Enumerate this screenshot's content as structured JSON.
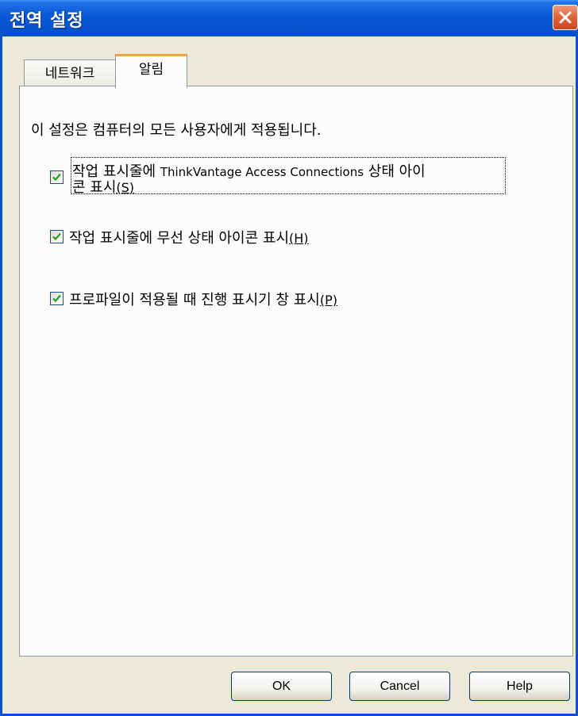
{
  "window": {
    "title": "전역 설정"
  },
  "tabs": [
    {
      "label": "네트워크",
      "selected": false
    },
    {
      "label": "알림",
      "selected": true
    }
  ],
  "panel": {
    "info_text": "이 설정은 컴퓨터의 모든 사용자에게 적용됩니다.",
    "checkboxes": [
      {
        "line1_prefix": "작업 표시줄에 ",
        "line1_mixed": "ThinkVantage Access Connections",
        "line1_suffix": " 상태 아이",
        "line2_text": "콘 표시",
        "mnemonic": "(S)",
        "checked": true
      },
      {
        "text": "작업 표시줄에 무선 상태 아이콘 표시",
        "mnemonic": "(H)",
        "checked": true
      },
      {
        "text": "프로파일이 적용될 때 진행 표시기 창 표시",
        "mnemonic": "(P)",
        "checked": true
      }
    ]
  },
  "buttons": {
    "ok": "OK",
    "cancel": "Cancel",
    "help": "Help"
  },
  "colors": {
    "titlebar": "#0554d2",
    "check": "#21a121",
    "selected_tab_accent": "#f3a43c",
    "close_button": "#e2653c"
  },
  "icons": {
    "close": "close-icon",
    "check": "checkmark-icon"
  }
}
